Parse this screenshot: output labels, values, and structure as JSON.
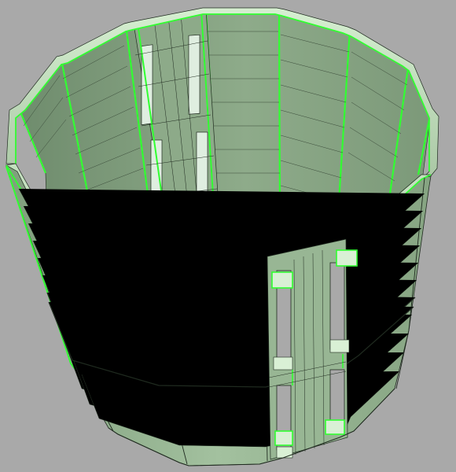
{
  "viewport": {
    "background_color": "#a9a9a9",
    "mode": "3d-wireframe-shaded"
  },
  "model": {
    "shape": "faceted-cylindrical-shell",
    "sides": 12,
    "open_top": true,
    "window_openings_per_slat": 2,
    "slatted_panels": 2,
    "colors": {
      "surface_light": "#c7e2c2",
      "surface_mid": "#9bb996",
      "surface_dark": "#7f9e7c",
      "interior_shadow": "#6f8c6d",
      "edge_highlight": "#31ff31",
      "wire": "#1f2a1f"
    }
  }
}
